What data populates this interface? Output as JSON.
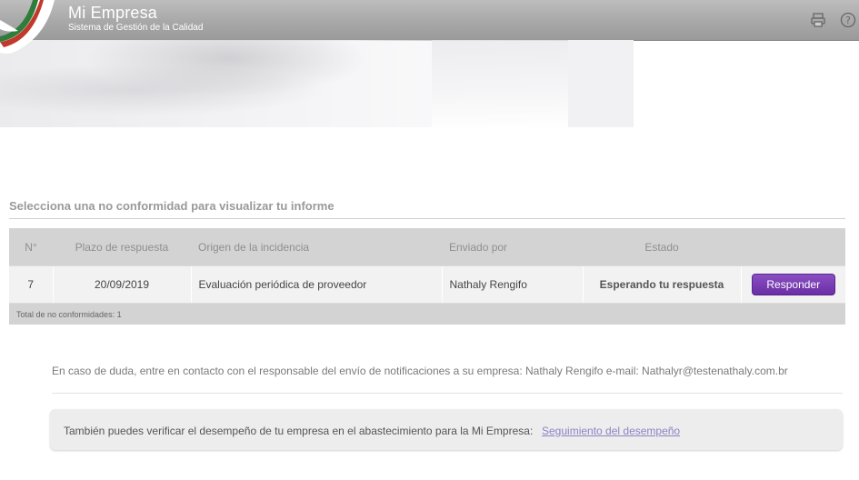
{
  "header": {
    "title": "Mi Empresa",
    "subtitle": "Sistema de Gestión de la Calidad",
    "print_icon": "printer-icon",
    "help_icon": "help-circle-icon"
  },
  "section": {
    "title": "Selecciona una no conformidad para visualizar tu informe"
  },
  "table": {
    "columns": [
      "N°",
      "Plazo de respuesta",
      "Origen de la incidencia",
      "Enviado por",
      "Estado"
    ],
    "rows": [
      {
        "number": "7",
        "deadline": "20/09/2019",
        "origin": "Evaluación periódica de proveedor",
        "sent_by": "Nathaly Rengifo",
        "status": "Esperando tu respuesta",
        "action_label": "Responder"
      }
    ],
    "footer": "Total de no conformidades: 1"
  },
  "contact_text": "En caso de duda, entre en contacto con el responsable del envío de notificaciones a su empresa: Nathaly Rengifo e-mail: Nathalyr@testenathaly.com.br",
  "performance": {
    "text": "También puedes verificar el desempeño de tu empresa en el abastecimiento para la Mi Empresa:",
    "link_label": "Seguimiento del desempeño"
  },
  "colors": {
    "button": "#7a3fb5",
    "header_bar": "#a8a8a8",
    "link": "#8b83c4"
  }
}
